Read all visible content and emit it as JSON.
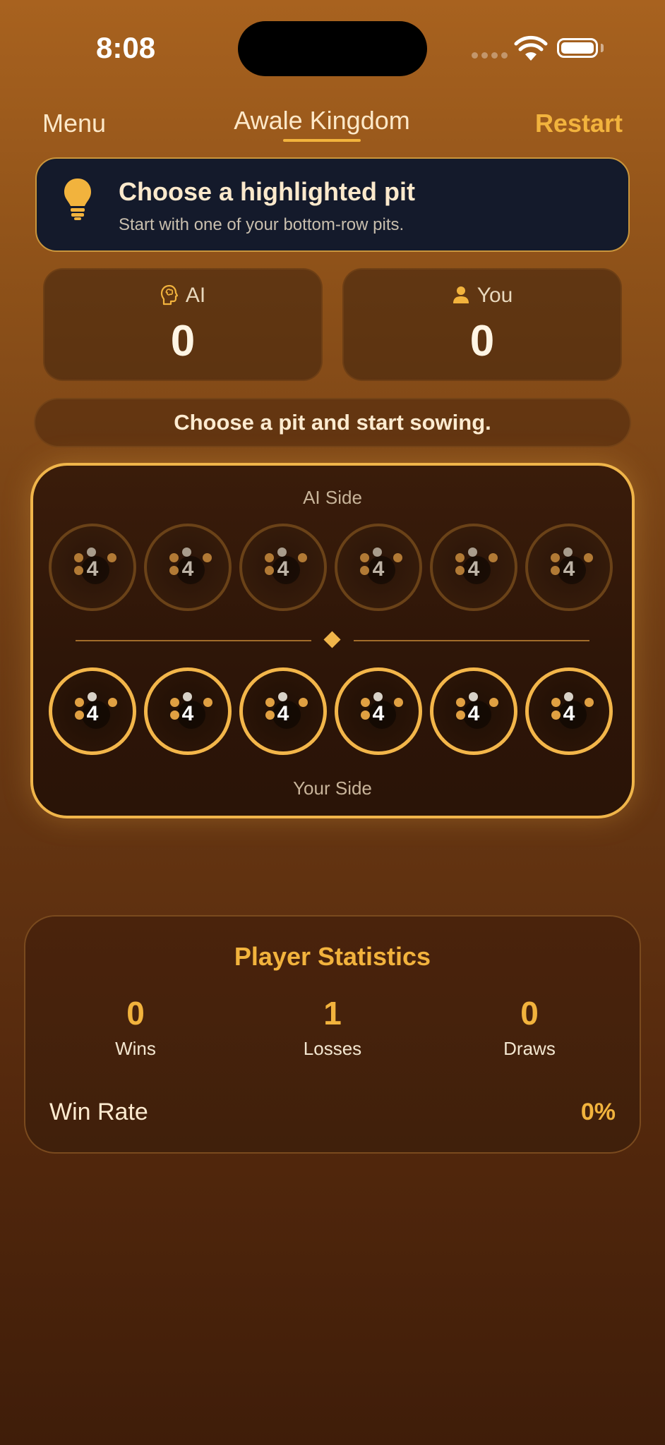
{
  "status_bar": {
    "time": "8:08"
  },
  "nav": {
    "menu_label": "Menu",
    "title": "Awale Kingdom",
    "restart_label": "Restart"
  },
  "hint": {
    "icon": "lightbulb-icon",
    "title": "Choose a highlighted pit",
    "subtitle": "Start with one of your bottom-row pits."
  },
  "scores": {
    "ai": {
      "label": "AI",
      "icon": "brain-head-icon",
      "value": "0"
    },
    "you": {
      "label": "You",
      "icon": "person-icon",
      "value": "0"
    }
  },
  "message": "Choose a pit and start sowing.",
  "board": {
    "ai_side_label": "AI Side",
    "your_side_label": "Your Side",
    "ai_pits": [
      "4",
      "4",
      "4",
      "4",
      "4",
      "4"
    ],
    "your_pits": [
      "4",
      "4",
      "4",
      "4",
      "4",
      "4"
    ]
  },
  "stats": {
    "title": "Player Statistics",
    "wins": {
      "value": "0",
      "label": "Wins"
    },
    "losses": {
      "value": "1",
      "label": "Losses"
    },
    "draws": {
      "value": "0",
      "label": "Draws"
    },
    "win_rate_label": "Win Rate",
    "win_rate_value": "0%"
  },
  "colors": {
    "accent": "#f2b33d",
    "hint_bg": "#141a2b",
    "board_border": "#f0b54a"
  }
}
